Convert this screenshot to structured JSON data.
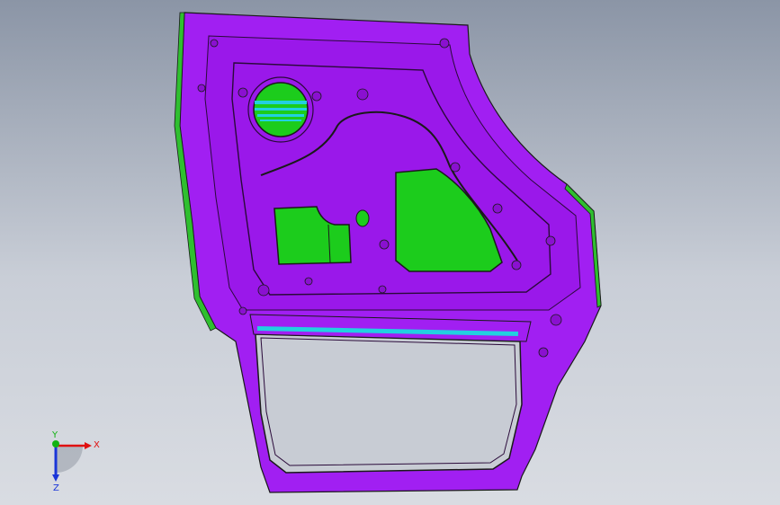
{
  "viewport": {
    "background_top": "#8b95a6",
    "background_bottom": "#d9dce2"
  },
  "model": {
    "part_color": "#a11ff2",
    "part_shadow_color": "#7a12c4",
    "edge_color": "#1a1a1a",
    "face_fill_color": "#1ccc1c",
    "accent_color": "#22d0e0"
  },
  "triad": {
    "x_label": "X",
    "y_label": "Y",
    "z_label": "Z",
    "x_color": "#e01010",
    "y_color": "#12b312",
    "z_color": "#1a35d8"
  }
}
